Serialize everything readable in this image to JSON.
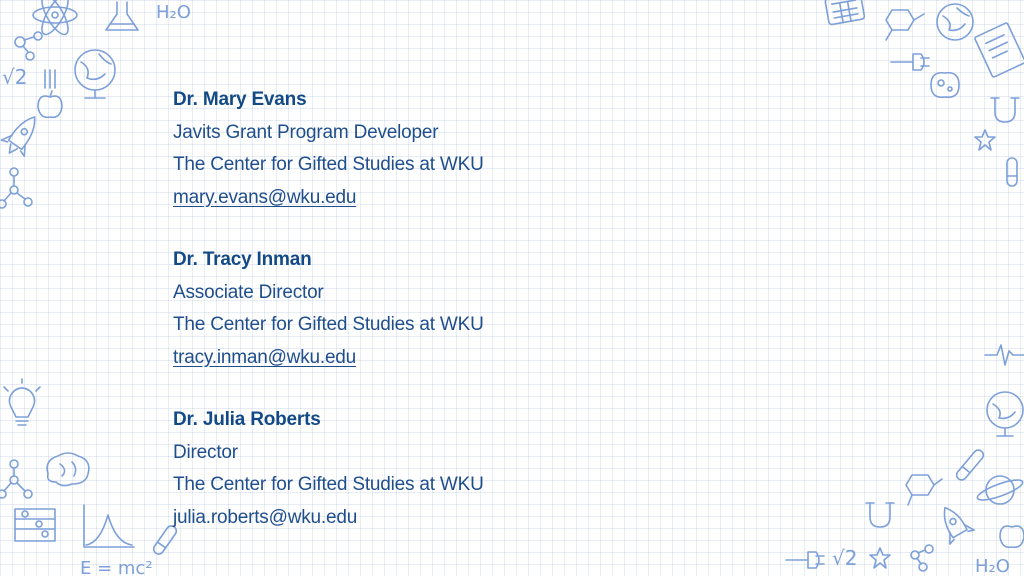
{
  "contacts": [
    {
      "name": "Dr. Mary Evans",
      "title": "Javits Grant Program Developer",
      "organization": "The Center for Gifted Studies at WKU",
      "email": "mary.evans@wku.edu",
      "email_linked": true
    },
    {
      "name": "Dr. Tracy Inman",
      "title": "Associate Director",
      "organization": "The Center for Gifted Studies at WKU",
      "email": "tracy.inman@wku.edu",
      "email_linked": true
    },
    {
      "name": "Dr. Julia Roberts",
      "title": "Director",
      "organization": "The Center for Gifted Studies at WKU",
      "email": "julia.roberts@wku.edu",
      "email_linked": false
    }
  ],
  "decor": {
    "formulas": [
      "H₂O",
      "√2",
      "E = mc²"
    ],
    "icons": [
      "atom-icon",
      "flask-icon",
      "globe-icon",
      "rocket-icon",
      "apple-icon",
      "molecule-icon",
      "lightbulb-icon",
      "brain-icon",
      "abacus-icon",
      "bell-curve-icon",
      "test-tube-icon",
      "calculator-icon",
      "plug-icon",
      "book-icon",
      "microbe-icon",
      "magnet-icon",
      "star-icon",
      "planet-icon",
      "pulse-icon"
    ],
    "doodle_color": "#7da0d8",
    "text_color": "#1f4e8c"
  }
}
